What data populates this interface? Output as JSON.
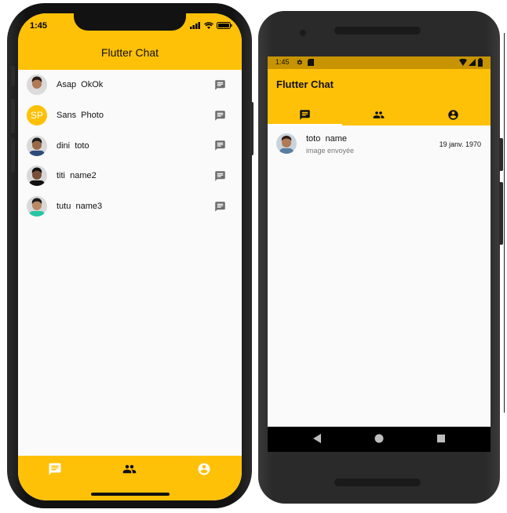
{
  "iphone": {
    "status_time": "1:45",
    "title": "Flutter Chat",
    "contacts": [
      {
        "name": "Asap  OkOk",
        "avatar": "photo",
        "skin": "#b07a55",
        "hair": "#2a1a10",
        "shirt": "#dcdcdc"
      },
      {
        "name": "Sans  Photo",
        "avatar": "initials",
        "initials": "SP"
      },
      {
        "name": "dini  toto",
        "avatar": "photo",
        "skin": "#9a6a48",
        "hair": "#1b1b1b",
        "shirt": "#2f4b7c"
      },
      {
        "name": "titi  name2",
        "avatar": "photo",
        "skin": "#7a5038",
        "hair": "#111111",
        "shirt": "#111111"
      },
      {
        "name": "tutu  name3",
        "avatar": "photo",
        "skin": "#b88a66",
        "hair": "#1a1a1a",
        "shirt": "#26c6a4"
      }
    ],
    "bottom_nav": [
      "chat-icon",
      "people-icon",
      "account-icon"
    ]
  },
  "android": {
    "status_time": "1:45",
    "title": "Flutter Chat",
    "tabs": [
      "chat-icon",
      "people-icon",
      "account-icon"
    ],
    "conversation": {
      "name": "toto  name",
      "last_message": "image envoyée",
      "date": "19 janv. 1970"
    },
    "nav": [
      "back-icon",
      "home-icon",
      "recents-icon"
    ]
  },
  "colors": {
    "accent": "#ffc107",
    "status_dark": "#c79400",
    "icon_gray": "#6d6d6d"
  }
}
